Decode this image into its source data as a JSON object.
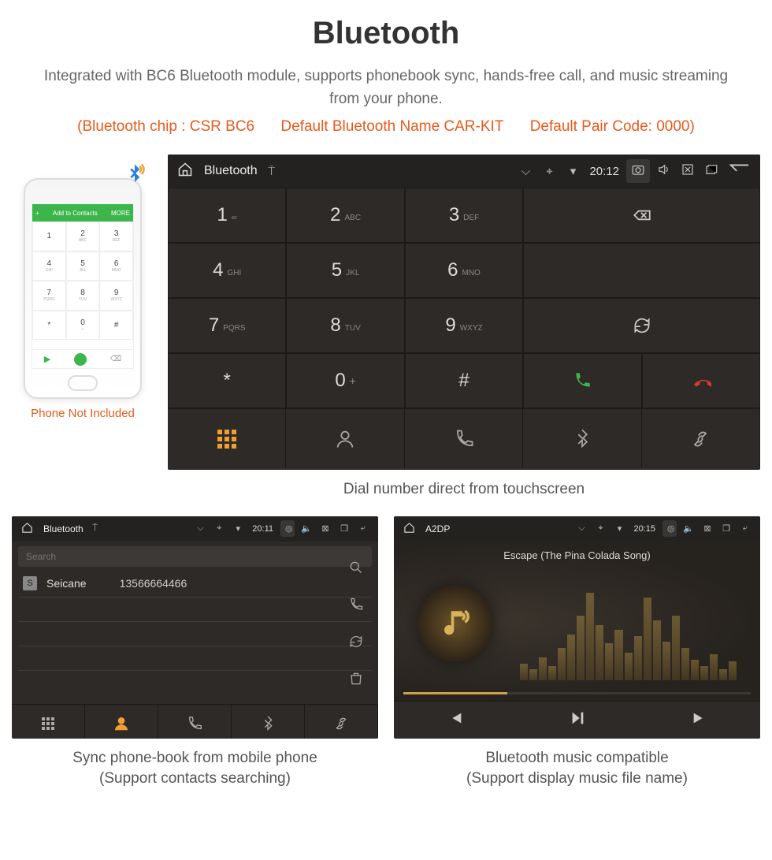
{
  "title": "Bluetooth",
  "subtitle": "Integrated with BC6 Bluetooth module, supports phonebook sync, hands-free call, and music streaming from your phone.",
  "specs": {
    "chip": "(Bluetooth chip : CSR BC6",
    "name": "Default Bluetooth Name CAR-KIT",
    "code": "Default Pair Code: 0000)"
  },
  "phone": {
    "header": "Add to Contacts",
    "more": "MORE",
    "keys": [
      {
        "d": "1",
        "s": ""
      },
      {
        "d": "2",
        "s": "ABC"
      },
      {
        "d": "3",
        "s": "DEF"
      },
      {
        "d": "4",
        "s": "GHI"
      },
      {
        "d": "5",
        "s": "JKL"
      },
      {
        "d": "6",
        "s": "MNO"
      },
      {
        "d": "7",
        "s": "PQRS"
      },
      {
        "d": "8",
        "s": "TUV"
      },
      {
        "d": "9",
        "s": "WXYZ"
      },
      {
        "d": "*",
        "s": ""
      },
      {
        "d": "0",
        "s": "+"
      },
      {
        "d": "#",
        "s": ""
      }
    ],
    "caption": "Phone Not Included"
  },
  "dialer": {
    "statusbar": {
      "title": "Bluetooth",
      "time": "20:12"
    },
    "keys": [
      {
        "d": "1",
        "s": "∞"
      },
      {
        "d": "2",
        "s": "ABC"
      },
      {
        "d": "3",
        "s": "DEF"
      },
      {
        "d": "4",
        "s": "GHI"
      },
      {
        "d": "5",
        "s": "JKL"
      },
      {
        "d": "6",
        "s": "MNO"
      },
      {
        "d": "7",
        "s": "PQRS"
      },
      {
        "d": "8",
        "s": "TUV"
      },
      {
        "d": "9",
        "s": "WXYZ"
      },
      {
        "d": "*",
        "s": ""
      },
      {
        "d": "0",
        "s": "+",
        "sup": "+"
      },
      {
        "d": "#",
        "s": ""
      }
    ],
    "caption": "Dial number direct from touchscreen"
  },
  "contacts": {
    "statusbar": {
      "title": "Bluetooth",
      "time": "20:11"
    },
    "search_placeholder": "Search",
    "row": {
      "badge": "S",
      "name": "Seicane",
      "number": "13566664466"
    },
    "caption_l1": "Sync phone-book from mobile phone",
    "caption_l2": "(Support contacts searching)"
  },
  "music": {
    "statusbar": {
      "title": "A2DP",
      "time": "20:15"
    },
    "track": "Escape (The Pina Colada Song)",
    "caption_l1": "Bluetooth music compatible",
    "caption_l2": "(Support display music file name)"
  }
}
